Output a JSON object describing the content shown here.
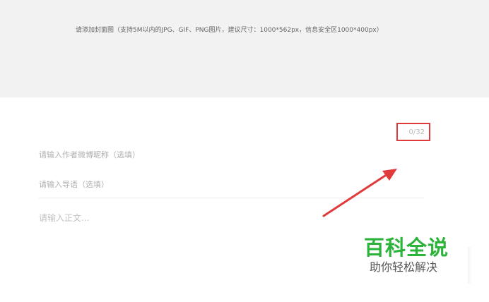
{
  "cover": {
    "hint": "请添加封面图（支持5M以内的JPG、GIF、PNG图片，建议尺寸：1000*562px，信息安全区1000*400px）"
  },
  "title": {
    "counter": "0/32"
  },
  "author": {
    "placeholder": "请输入作者微博昵称（选填）"
  },
  "summary": {
    "placeholder": "请输入导语（选填）"
  },
  "body": {
    "placeholder": "请输入正文..."
  },
  "watermark": {
    "title": "百科全说",
    "subtitle": "助你轻松解决"
  },
  "colors": {
    "highlight": "#e03a3a",
    "watermark_green": "#2bb33a"
  }
}
